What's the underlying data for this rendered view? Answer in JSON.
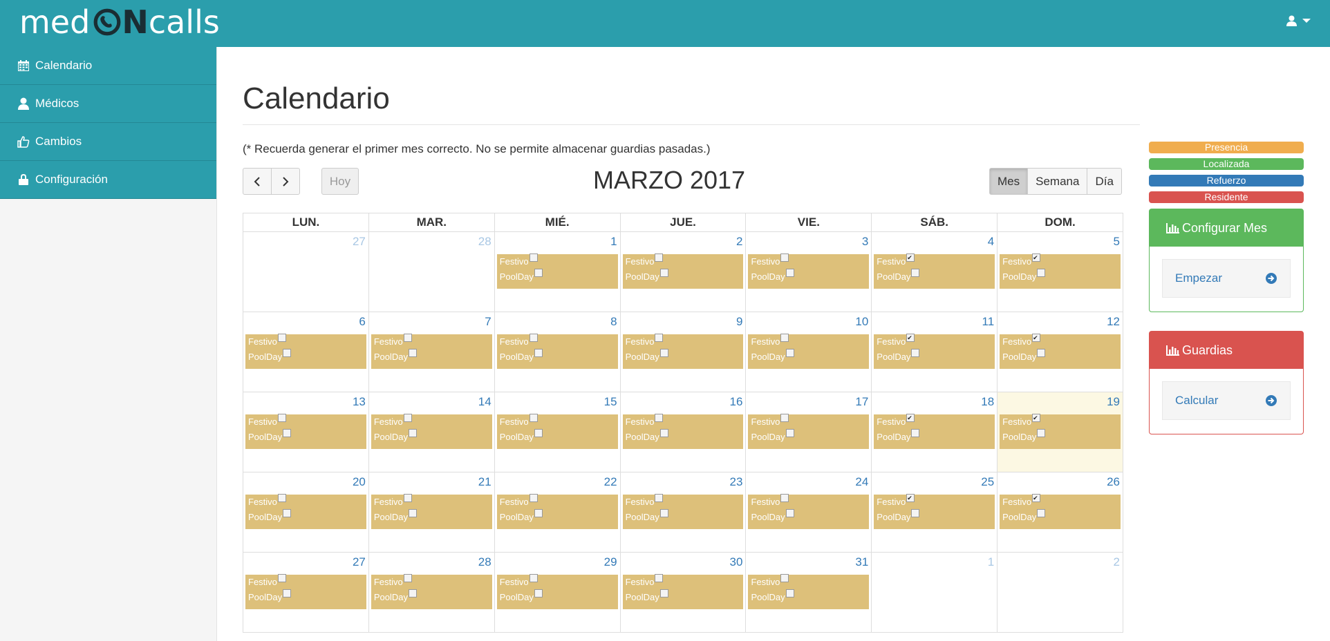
{
  "app": {
    "logo_left": "med",
    "logo_on": "N",
    "logo_right": "calls"
  },
  "sidebar": {
    "items": [
      {
        "label": "Calendario",
        "icon": "calendar-icon"
      },
      {
        "label": "Médicos",
        "icon": "user-icon"
      },
      {
        "label": "Cambios",
        "icon": "thumbs-up-icon"
      },
      {
        "label": "Configuración",
        "icon": "lock-icon"
      }
    ]
  },
  "main": {
    "title": "Calendario",
    "note": "(* Recuerda generar el primer mes correcto. No se permite almacenar guardias pasadas.)",
    "today_label": "Hoy",
    "month_title": "MARZO 2017",
    "views": [
      "Mes",
      "Semana",
      "Día"
    ],
    "active_view": "Mes"
  },
  "calendar": {
    "weekdays": [
      "LUN.",
      "MAR.",
      "MIÉ.",
      "JUE.",
      "VIE.",
      "SÁB.",
      "DOM."
    ],
    "event_labels": {
      "festivo": "Festivo",
      "poolday": "PoolDay"
    },
    "event_color": "#ddc07a",
    "weeks": [
      [
        {
          "day": "27",
          "other": true,
          "event": false
        },
        {
          "day": "28",
          "other": true,
          "event": false
        },
        {
          "day": "1",
          "event": true,
          "festivo": false,
          "poolday": false
        },
        {
          "day": "2",
          "event": true,
          "festivo": false,
          "poolday": false
        },
        {
          "day": "3",
          "event": true,
          "festivo": false,
          "poolday": false
        },
        {
          "day": "4",
          "event": true,
          "festivo": true,
          "poolday": false
        },
        {
          "day": "5",
          "event": true,
          "festivo": true,
          "poolday": false
        }
      ],
      [
        {
          "day": "6",
          "event": true,
          "festivo": false,
          "poolday": false
        },
        {
          "day": "7",
          "event": true,
          "festivo": false,
          "poolday": false
        },
        {
          "day": "8",
          "event": true,
          "festivo": false,
          "poolday": false
        },
        {
          "day": "9",
          "event": true,
          "festivo": false,
          "poolday": false
        },
        {
          "day": "10",
          "event": true,
          "festivo": false,
          "poolday": false
        },
        {
          "day": "11",
          "event": true,
          "festivo": true,
          "poolday": false
        },
        {
          "day": "12",
          "event": true,
          "festivo": true,
          "poolday": false
        }
      ],
      [
        {
          "day": "13",
          "event": true,
          "festivo": false,
          "poolday": false
        },
        {
          "day": "14",
          "event": true,
          "festivo": false,
          "poolday": false
        },
        {
          "day": "15",
          "event": true,
          "festivo": false,
          "poolday": false
        },
        {
          "day": "16",
          "event": true,
          "festivo": false,
          "poolday": false
        },
        {
          "day": "17",
          "event": true,
          "festivo": false,
          "poolday": false
        },
        {
          "day": "18",
          "event": true,
          "festivo": true,
          "poolday": false
        },
        {
          "day": "19",
          "event": true,
          "festivo": true,
          "poolday": false,
          "today": true
        }
      ],
      [
        {
          "day": "20",
          "event": true,
          "festivo": false,
          "poolday": false
        },
        {
          "day": "21",
          "event": true,
          "festivo": false,
          "poolday": false
        },
        {
          "day": "22",
          "event": true,
          "festivo": false,
          "poolday": false
        },
        {
          "day": "23",
          "event": true,
          "festivo": false,
          "poolday": false
        },
        {
          "day": "24",
          "event": true,
          "festivo": false,
          "poolday": false
        },
        {
          "day": "25",
          "event": true,
          "festivo": true,
          "poolday": false
        },
        {
          "day": "26",
          "event": true,
          "festivo": true,
          "poolday": false
        }
      ],
      [
        {
          "day": "27",
          "event": true,
          "festivo": false,
          "poolday": false
        },
        {
          "day": "28",
          "event": true,
          "festivo": false,
          "poolday": false
        },
        {
          "day": "29",
          "event": true,
          "festivo": false,
          "poolday": false
        },
        {
          "day": "30",
          "event": true,
          "festivo": false,
          "poolday": false
        },
        {
          "day": "31",
          "event": true,
          "festivo": false,
          "poolday": false
        },
        {
          "day": "1",
          "other": true,
          "event": false
        },
        {
          "day": "2",
          "other": true,
          "event": false
        }
      ]
    ]
  },
  "legend": [
    {
      "label": "Presencia",
      "color": "#f0ad4e"
    },
    {
      "label": "Localizada",
      "color": "#5cb85c"
    },
    {
      "label": "Refuerzo",
      "color": "#337ab7"
    },
    {
      "label": "Residente",
      "color": "#d9534f"
    }
  ],
  "panels": {
    "configurar": {
      "title": "Configurar Mes",
      "action": "Empezar",
      "color": "#5cb85c"
    },
    "guardias": {
      "title": "Guardias",
      "action": "Calcular",
      "color": "#d9534f"
    }
  }
}
